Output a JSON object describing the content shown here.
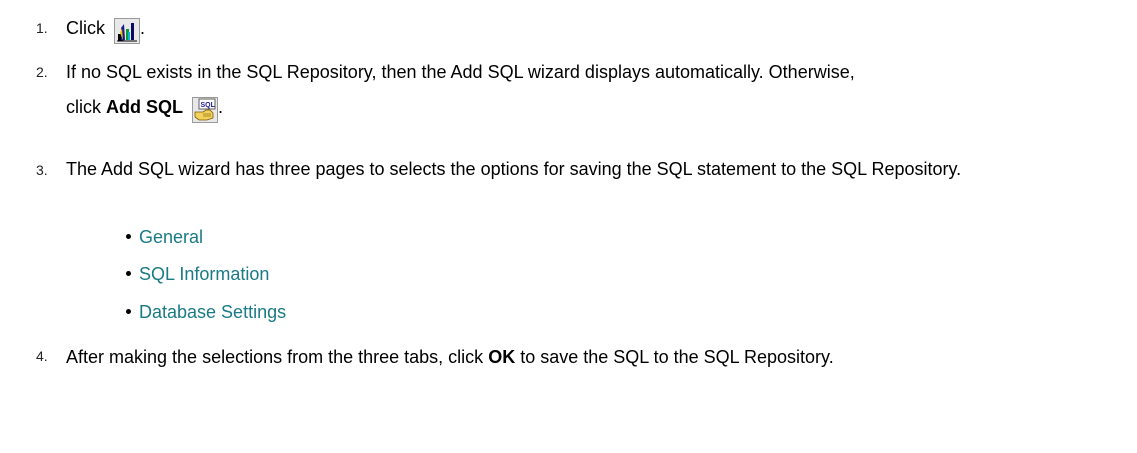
{
  "steps": [
    {
      "number": "1.",
      "before": "Click",
      "icon": "bar-chart-icon",
      "after": "."
    },
    {
      "number": "2.",
      "line1": "If no SQL exists in the SQL Repository, then the Add SQL wizard displays automatically. Otherwise,",
      "click": "click",
      "bold": "Add SQL",
      "icon": "add-sql-icon",
      "after": "."
    },
    {
      "number": "3.",
      "text": "The Add SQL wizard has three pages to selects the options for saving the SQL statement to the SQL Repository.",
      "links": [
        "General",
        "SQL Information",
        "Database Settings"
      ]
    },
    {
      "number": "4.",
      "before": "After making the selections from the three tabs, click",
      "bold": "OK",
      "after": "to save the SQL to the SQL Repository."
    }
  ],
  "colors": {
    "link": "#1a7a85",
    "text": "#000000"
  }
}
